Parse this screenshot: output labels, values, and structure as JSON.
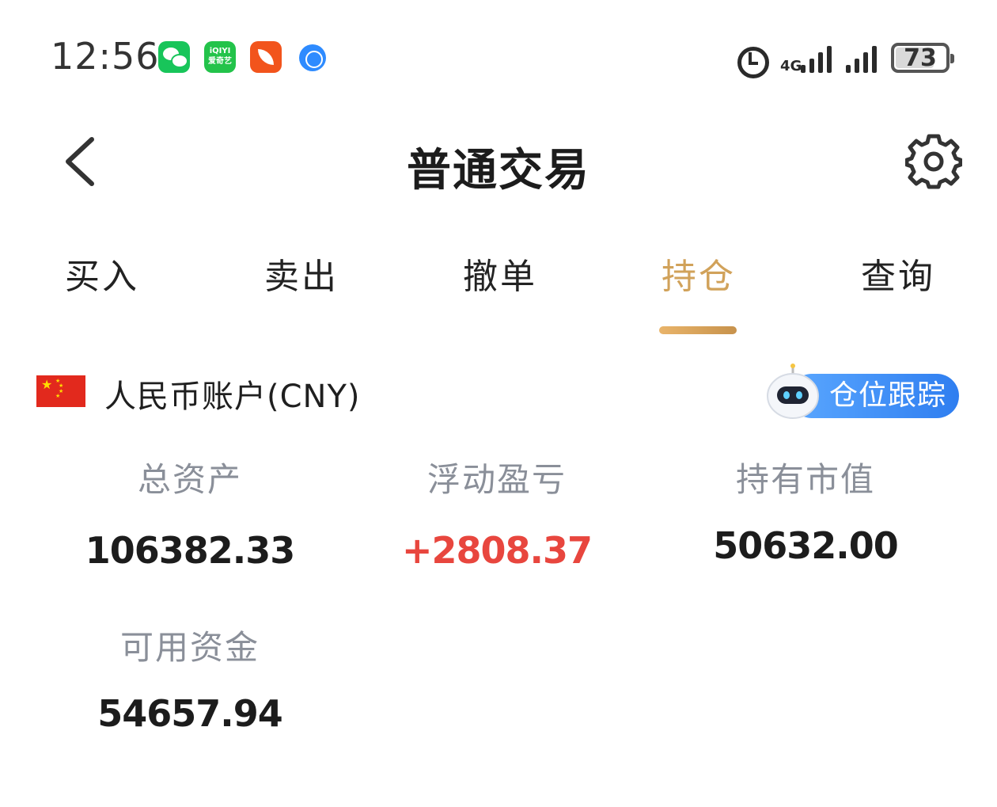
{
  "status_bar": {
    "time": "12:56",
    "apps": [
      "wechat-icon",
      "iqiyi-icon",
      "feishu-icon",
      "browser-icon"
    ],
    "iqiyi_text": "iQIYI 爱奇艺",
    "network": "4G",
    "battery": "73"
  },
  "header": {
    "title": "普通交易",
    "back_icon": "chevron-left-icon",
    "settings_icon": "gear-icon"
  },
  "tabs": [
    {
      "label": "买入",
      "active": false
    },
    {
      "label": "卖出",
      "active": false
    },
    {
      "label": "撤单",
      "active": false
    },
    {
      "label": "持仓",
      "active": true
    },
    {
      "label": "查询",
      "active": false
    }
  ],
  "account": {
    "name": "人民币账户(CNY)",
    "flag": "china-flag-icon",
    "track_button": "仓位跟踪"
  },
  "stats": {
    "total_assets": {
      "label": "总资产",
      "value": "106382.33"
    },
    "floating_pl": {
      "label": "浮动盈亏",
      "value": "+2808.37"
    },
    "market_value": {
      "label": "持有市值",
      "value": "50632.00"
    },
    "available_funds": {
      "label": "可用资金",
      "value": "54657.94"
    }
  },
  "colors": {
    "accent": "#d1a25a",
    "profit": "#e8463e",
    "button_blue": "#3d8cf5",
    "label_gray": "#8a8f99"
  }
}
